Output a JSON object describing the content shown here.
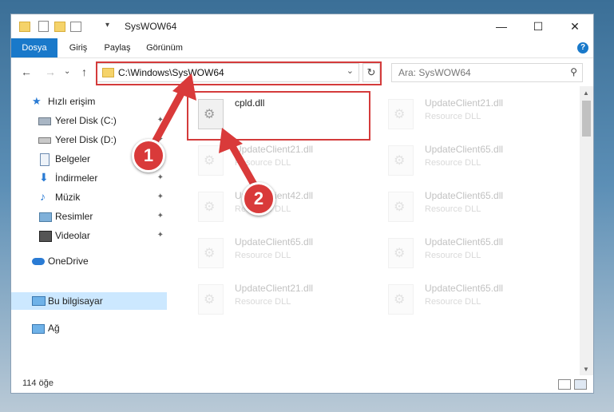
{
  "window": {
    "title": "SysWOW64"
  },
  "ribbon": {
    "tabs": [
      "Dosya",
      "Giriş",
      "Paylaş",
      "Görünüm"
    ],
    "help": "?"
  },
  "address": {
    "path": "C:\\Windows\\SysWOW64"
  },
  "search": {
    "placeholder": "Ara: SysWOW64"
  },
  "sidebar": {
    "items": [
      {
        "label": "Hızlı erişim"
      },
      {
        "label": "Yerel Disk (C:)"
      },
      {
        "label": "Yerel Disk (D:)"
      },
      {
        "label": "Belgeler"
      },
      {
        "label": "İndirmeler"
      },
      {
        "label": "Müzik"
      },
      {
        "label": "Resimler"
      },
      {
        "label": "Videolar"
      },
      {
        "label": "OneDrive"
      },
      {
        "label": "Bu bilgisayar"
      },
      {
        "label": "Ağ"
      }
    ]
  },
  "files": [
    {
      "name": "cpld.dll",
      "type": ""
    },
    {
      "name": "UpdateClient21.dll",
      "type": "Resource DLL"
    },
    {
      "name": "UpdateClient21.dll",
      "type": "Resource DLL"
    },
    {
      "name": "UpdateClient65.dll",
      "type": "Resource DLL"
    },
    {
      "name": "UpdateClient42.dll",
      "type": "Resource DLL"
    },
    {
      "name": "UpdateClient65.dll",
      "type": "Resource DLL"
    },
    {
      "name": "UpdateClient65.dll",
      "type": "Resource DLL"
    },
    {
      "name": "UpdateClient65.dll",
      "type": "Resource DLL"
    },
    {
      "name": "UpdateClient21.dll",
      "type": "Resource DLL"
    },
    {
      "name": "UpdateClient65.dll",
      "type": "Resource DLL"
    }
  ],
  "status": {
    "count": "114 öğe"
  },
  "annotations": {
    "badge1": "1",
    "badge2": "2"
  },
  "colors": {
    "accent": "#1979ca",
    "highlight": "#d43b3b",
    "badge": "#d93a3a"
  }
}
